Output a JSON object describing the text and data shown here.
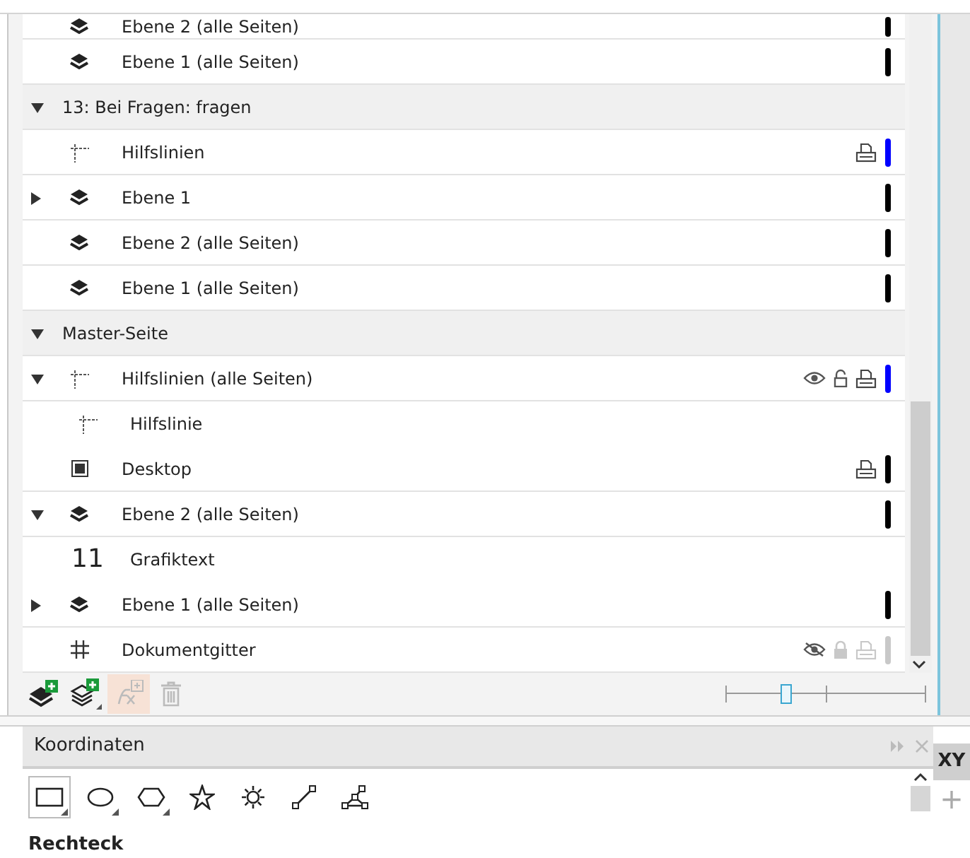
{
  "layers": {
    "rows": [
      {
        "kind": "layer",
        "label": "Ebene 2 (alle Seiten)",
        "color": "#000000"
      },
      {
        "kind": "layer",
        "label": "Ebene 1 (alle Seiten)",
        "color": "#000000"
      },
      {
        "kind": "page",
        "expanded": true,
        "label": "13: Bei Fragen: fragen"
      },
      {
        "kind": "guides",
        "label": "Hilfslinien",
        "printable": true,
        "color": "#0000ff"
      },
      {
        "kind": "layer",
        "expanded": false,
        "label": "Ebene 1",
        "color": "#000000"
      },
      {
        "kind": "layer",
        "label": "Ebene 2 (alle Seiten)",
        "color": "#000000"
      },
      {
        "kind": "layer",
        "label": "Ebene 1 (alle Seiten)",
        "color": "#000000"
      },
      {
        "kind": "page",
        "expanded": true,
        "label": "Master-Seite"
      },
      {
        "kind": "guides",
        "expanded": true,
        "label": "Hilfslinien (alle Seiten)",
        "visible": true,
        "locked": false,
        "printable": true,
        "color": "#0000ff"
      },
      {
        "kind": "guide",
        "label": "Hilfslinie"
      },
      {
        "kind": "desktop",
        "label": "Desktop",
        "printable": true,
        "color": "#000000"
      },
      {
        "kind": "layer",
        "expanded": true,
        "label": "Ebene 2 (alle Seiten)",
        "color": "#000000"
      },
      {
        "kind": "text",
        "icon_text": "11",
        "label": "Grafiktext"
      },
      {
        "kind": "layer",
        "expanded": false,
        "label": "Ebene 1 (alle Seiten)",
        "color": "#000000"
      },
      {
        "kind": "grid",
        "label": "Dokumentgitter",
        "visible": false,
        "locked": true,
        "printable": false,
        "color": "#c8c8c8"
      }
    ]
  },
  "toolbar": {
    "buttons": [
      {
        "kind": "new-layer",
        "disabled": false,
        "hovered": false
      },
      {
        "kind": "new-master-layer",
        "disabled": false,
        "hovered": false
      },
      {
        "kind": "effect",
        "disabled": true,
        "hovered": true
      },
      {
        "kind": "delete",
        "disabled": true,
        "hovered": false
      }
    ],
    "zoom_slider": {
      "level": 0.3
    }
  },
  "coordinates": {
    "title": "Koordinaten",
    "tools": [
      {
        "kind": "rectangle",
        "selected": true,
        "flyout": true
      },
      {
        "kind": "ellipse",
        "selected": false,
        "flyout": true
      },
      {
        "kind": "polygon",
        "selected": false,
        "flyout": true
      },
      {
        "kind": "star",
        "selected": false,
        "flyout": false
      },
      {
        "kind": "complex-star",
        "selected": false,
        "flyout": false
      },
      {
        "kind": "line",
        "selected": false,
        "flyout": false
      },
      {
        "kind": "polyline",
        "selected": false,
        "flyout": false
      }
    ],
    "section_title": "Rechteck",
    "side_tabs": [
      {
        "label": "XY",
        "selected": true
      }
    ],
    "add_tab": "+"
  }
}
